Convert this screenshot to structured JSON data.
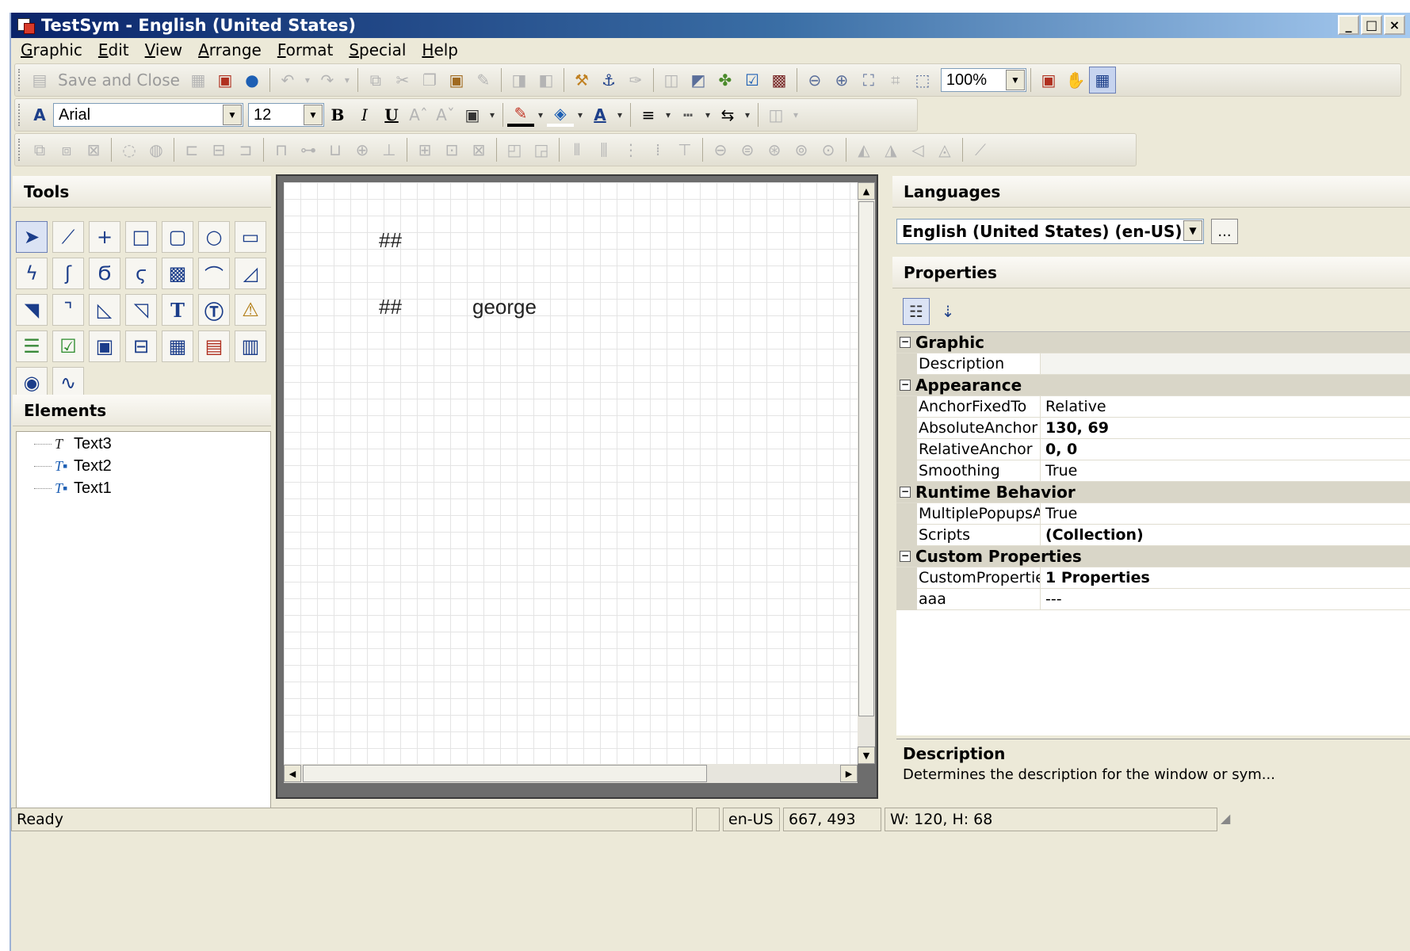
{
  "window": {
    "title": "TestSym - English (United States)",
    "min": "_",
    "max": "□",
    "close": "×"
  },
  "menu": [
    {
      "key": "G",
      "rest": "raphic"
    },
    {
      "key": "E",
      "rest": "dit"
    },
    {
      "key": "V",
      "rest": "iew"
    },
    {
      "key": "A",
      "rest": "rrange"
    },
    {
      "key": "F",
      "rest": "ormat"
    },
    {
      "key": "S",
      "rest": "pecial"
    },
    {
      "key": "H",
      "rest": "elp"
    }
  ],
  "toolbar1": {
    "save_close": "Save and Close",
    "zoom": "100%"
  },
  "format_toolbar": {
    "font": "Arial",
    "size": "12",
    "bold": "B",
    "italic": "I",
    "underline": "U",
    "color_a": "A"
  },
  "panels": {
    "tools": "Tools",
    "elements": "Elements",
    "languages": "Languages",
    "properties": "Properties"
  },
  "elements": [
    "Text3",
    "Text2",
    "Text1"
  ],
  "canvas": {
    "text1": "##",
    "text2": "##",
    "text3": "george"
  },
  "language": {
    "selected": "English (United States) (en-US)",
    "more": "..."
  },
  "properties": {
    "graphic": "Graphic",
    "description": "Description",
    "appearance": "Appearance",
    "anchor_fixed_to": {
      "name": "AnchorFixedTo",
      "value": "Relative"
    },
    "absolute_anchor": {
      "name": "AbsoluteAnchor",
      "value": "130, 69"
    },
    "relative_anchor": {
      "name": "RelativeAnchor",
      "value": "0, 0"
    },
    "smoothing": {
      "name": "Smoothing",
      "value": "True"
    },
    "runtime_behavior": "Runtime Behavior",
    "multiple_popups": {
      "name": "MultiplePopupsAllo",
      "value": "True"
    },
    "scripts": {
      "name": "Scripts",
      "value": "(Collection)"
    },
    "custom_properties_cat": "Custom Properties",
    "custom_properties": {
      "name": "CustomProperties",
      "value": "1 Properties"
    },
    "aaa": {
      "name": "aaa",
      "value": "---"
    }
  },
  "description_box": {
    "title": "Description",
    "text": "Determines the description for the window or sym..."
  },
  "status": {
    "ready": "Ready",
    "lang": "en-US",
    "coords": "667, 493",
    "size": "W: 120, H: 68"
  }
}
